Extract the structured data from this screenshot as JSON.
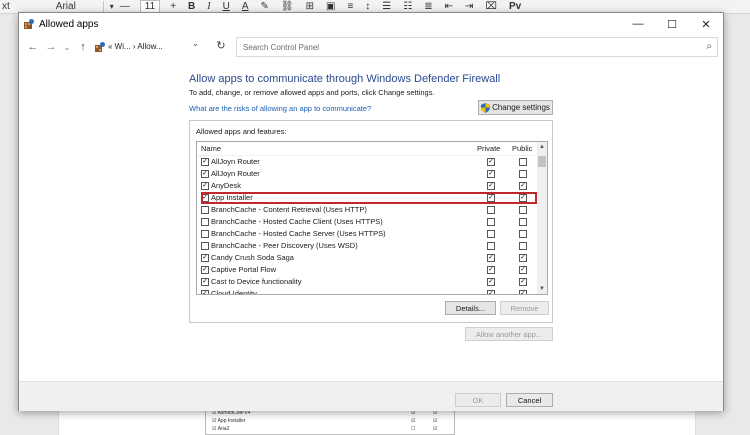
{
  "background_toolbar": {
    "style_fragment": "xt",
    "font_name": "Arial",
    "font_size": "11",
    "items": [
      "—",
      "+",
      "B",
      "I",
      "U",
      "A",
      "✎",
      "⛓",
      "⊞",
      "▣",
      "≡",
      "↕",
      "☰",
      "☷",
      "≣",
      "⇤",
      "⇥",
      "⌧",
      "Pv"
    ]
  },
  "background_doc": {
    "rows": [
      {
        "name": "☑ AsmedCMPV4",
        "c1": "☑",
        "c2": "☑"
      },
      {
        "name": "☑ App Installer",
        "c1": "☑",
        "c2": "☑"
      },
      {
        "name": "☑ Aria2",
        "c1": "☐",
        "c2": "☑"
      }
    ]
  },
  "window": {
    "title": "Allowed apps",
    "controls": {
      "minimize": "—",
      "maximize": "☐",
      "close": "✕"
    }
  },
  "addressbar": {
    "back": "←",
    "forward": "→",
    "recent": "⌄",
    "up": "↑",
    "path": "« Wi... › Allow...",
    "dropdown": "⌄",
    "refresh": "↻",
    "search_placeholder": "Search Control Panel",
    "search_icon": "⌕"
  },
  "main": {
    "heading": "Allow apps to communicate through Windows Defender Firewall",
    "subtext": "To add, change, or remove allowed apps and ports, click Change settings.",
    "risk_link": "What are the risks of allowing an app to communicate?",
    "change_settings_label": "Change settings",
    "group_label": "Allowed apps and features:",
    "columns": {
      "name": "Name",
      "private": "Private",
      "public": "Public"
    },
    "apps": [
      {
        "name": "AllJoyn Router",
        "enabled": true,
        "private": true,
        "public": false
      },
      {
        "name": "AllJoyn Router",
        "enabled": true,
        "private": true,
        "public": false
      },
      {
        "name": "AnyDesk",
        "enabled": true,
        "private": true,
        "public": true,
        "highlighted": true
      },
      {
        "name": "App Installer",
        "enabled": true,
        "private": true,
        "public": true
      },
      {
        "name": "BranchCache - Content Retrieval (Uses HTTP)",
        "enabled": false,
        "private": false,
        "public": false
      },
      {
        "name": "BranchCache - Hosted Cache Client (Uses HTTPS)",
        "enabled": false,
        "private": false,
        "public": false
      },
      {
        "name": "BranchCache - Hosted Cache Server (Uses HTTPS)",
        "enabled": false,
        "private": false,
        "public": false
      },
      {
        "name": "BranchCache - Peer Discovery (Uses WSD)",
        "enabled": false,
        "private": false,
        "public": false
      },
      {
        "name": "Candy Crush Soda Saga",
        "enabled": true,
        "private": true,
        "public": true
      },
      {
        "name": "Captive Portal Flow",
        "enabled": true,
        "private": true,
        "public": true
      },
      {
        "name": "Cast to Device functionality",
        "enabled": true,
        "private": true,
        "public": true
      },
      {
        "name": "Cloud Identity",
        "enabled": true,
        "private": true,
        "public": true
      }
    ],
    "details_label": "Details...",
    "remove_label": "Remove",
    "allow_another_label": "Allow another app..."
  },
  "footer": {
    "ok_label": "OK",
    "cancel_label": "Cancel"
  },
  "colors": {
    "heading": "#2b4a8c",
    "link": "#1a5fb4",
    "highlight_border": "#c1272d"
  }
}
